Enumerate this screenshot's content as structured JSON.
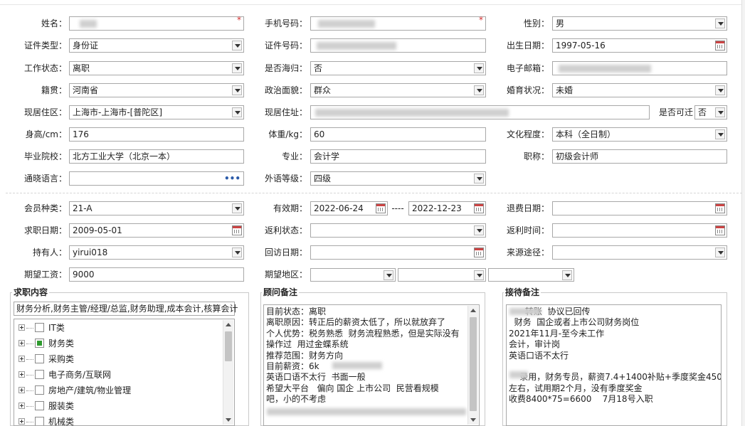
{
  "form": {
    "name": {
      "label": "姓名："
    },
    "phone": {
      "label": "手机号码："
    },
    "gender": {
      "label": "性别：",
      "value": "男"
    },
    "id_type": {
      "label": "证件类型：",
      "value": "身份证"
    },
    "id_no": {
      "label": "证件号码："
    },
    "birth": {
      "label": "出生日期：",
      "value": "1997-05-16"
    },
    "work_status": {
      "label": "工作状态：",
      "value": "离职"
    },
    "overseas": {
      "label": "是否海归：",
      "value": "否"
    },
    "email": {
      "label": "电子邮箱："
    },
    "native": {
      "label": "籍贯：",
      "value": "河南省"
    },
    "political": {
      "label": "政治面貌：",
      "value": "群众"
    },
    "marital": {
      "label": "婚育状况：",
      "value": "未婚"
    },
    "residence": {
      "label": "现居住区：",
      "value": "上海市-上海市-[普陀区]"
    },
    "address": {
      "label": "现居住址："
    },
    "relocate": {
      "label": "是否可迁",
      "value": "否"
    },
    "height": {
      "label": "身高/cm：",
      "value": "176"
    },
    "weight": {
      "label": "体重/kg：",
      "value": "60"
    },
    "education": {
      "label": "文化程度：",
      "value": "本科（全日制）"
    },
    "school": {
      "label": "毕业院校：",
      "value": "北方工业大学（北京一本）"
    },
    "major": {
      "label": "专业：",
      "value": "会计学"
    },
    "title": {
      "label": "职称：",
      "value": "初级会计师"
    },
    "languages": {
      "label": "通晓语言：",
      "value": ""
    },
    "foreign_level": {
      "label": "外语等级：",
      "value": "四级"
    }
  },
  "member": {
    "type": {
      "label": "会员种类：",
      "value": "21-A"
    },
    "validity": {
      "label": "有效期：",
      "from": "2022-06-24",
      "sep": "----",
      "to": "2022-12-23"
    },
    "refund_date": {
      "label": "退费日期：",
      "value": ""
    },
    "job_date": {
      "label": "求职日期：",
      "value": "2009-05-01"
    },
    "rebate_status": {
      "label": "返利状态：",
      "value": ""
    },
    "rebate_time": {
      "label": "返利时间：",
      "value": ""
    },
    "holder": {
      "label": "持有人：",
      "value": "yirui018"
    },
    "visit_date": {
      "label": "回访日期：",
      "value": ""
    },
    "source": {
      "label": "来源途径：",
      "value": ""
    },
    "salary": {
      "label": "期望工资：",
      "value": "9000"
    },
    "region": {
      "label": "期望地区：",
      "values": [
        "",
        "",
        ""
      ]
    }
  },
  "job": {
    "title": "求职内容",
    "summary": "财务分析,财务主管/经理/总监,财务助理,成本会计,核算会计",
    "tree": [
      {
        "label": "IT类",
        "checked": false
      },
      {
        "label": "财务类",
        "checked": true
      },
      {
        "label": "采购类",
        "checked": false
      },
      {
        "label": "电子商务/互联网",
        "checked": false
      },
      {
        "label": "房地产/建筑/物业管理",
        "checked": false
      },
      {
        "label": "服装类",
        "checked": false
      },
      {
        "label": "机械类",
        "checked": false
      }
    ]
  },
  "advisor": {
    "title": "顾问备注",
    "text": "目前状态：离职\n离职原因：转正后的薪资太低了，所以就放弃了\n个人优势：税务熟悉  财务流程熟悉，但是实际没有\n操作过  用过金蝶系统\n推荐范围：财务方向\n目前薪资：6k\n英语口语不太行  书面一般\n希望大平台   偏向 国企 上市公司  民营看规模\n吧，小的不考虑"
  },
  "reception": {
    "title": "接待备注",
    "text": "      转账  协议已回传\n  财务  国企或者上市公司财务岗位\n2021年11月-至今未工作\n会计，审计岗\n英语口语不太行\n\n    录用，财务专员，薪资7.4+1400补贴+季度奖金4500\n左右，试用期2个月，没有季度奖金\n收费8400*75=6600    7月18号入职"
  },
  "colors": {
    "required": "#d32f2f",
    "checked": "#2e9b2e",
    "border": "#a8a8a8"
  }
}
